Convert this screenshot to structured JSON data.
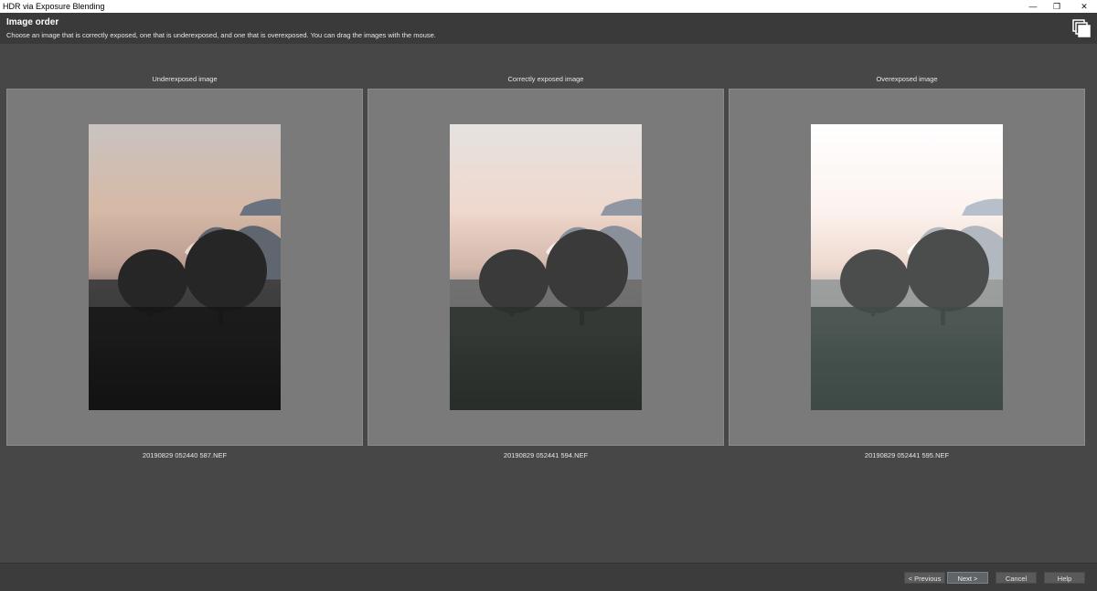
{
  "window": {
    "title": "HDR via Exposure Blending",
    "minimize": "—",
    "restore": "❐",
    "close": "✕"
  },
  "header": {
    "title": "Image order",
    "subtitle": "Choose an image that is correctly exposed, one that is underexposed, and one that is overexposed. You can drag the images with the mouse.",
    "icon": "stacked-images-icon"
  },
  "panels": [
    {
      "label": "Underexposed image",
      "file": "20190829 052440 587.NEF",
      "exposure": "under"
    },
    {
      "label": "Correctly exposed image",
      "file": "20190829 052441 594.NEF",
      "exposure": "correct"
    },
    {
      "label": "Overexposed image",
      "file": "20190829 052441 595.NEF",
      "exposure": "over"
    }
  ],
  "footer": {
    "previous": "< Previous",
    "next": "Next >",
    "cancel": "Cancel",
    "help": "Help"
  },
  "colors": {
    "background": "#474747",
    "header": "#3a3a3a",
    "panel": "#7a7a7a"
  }
}
